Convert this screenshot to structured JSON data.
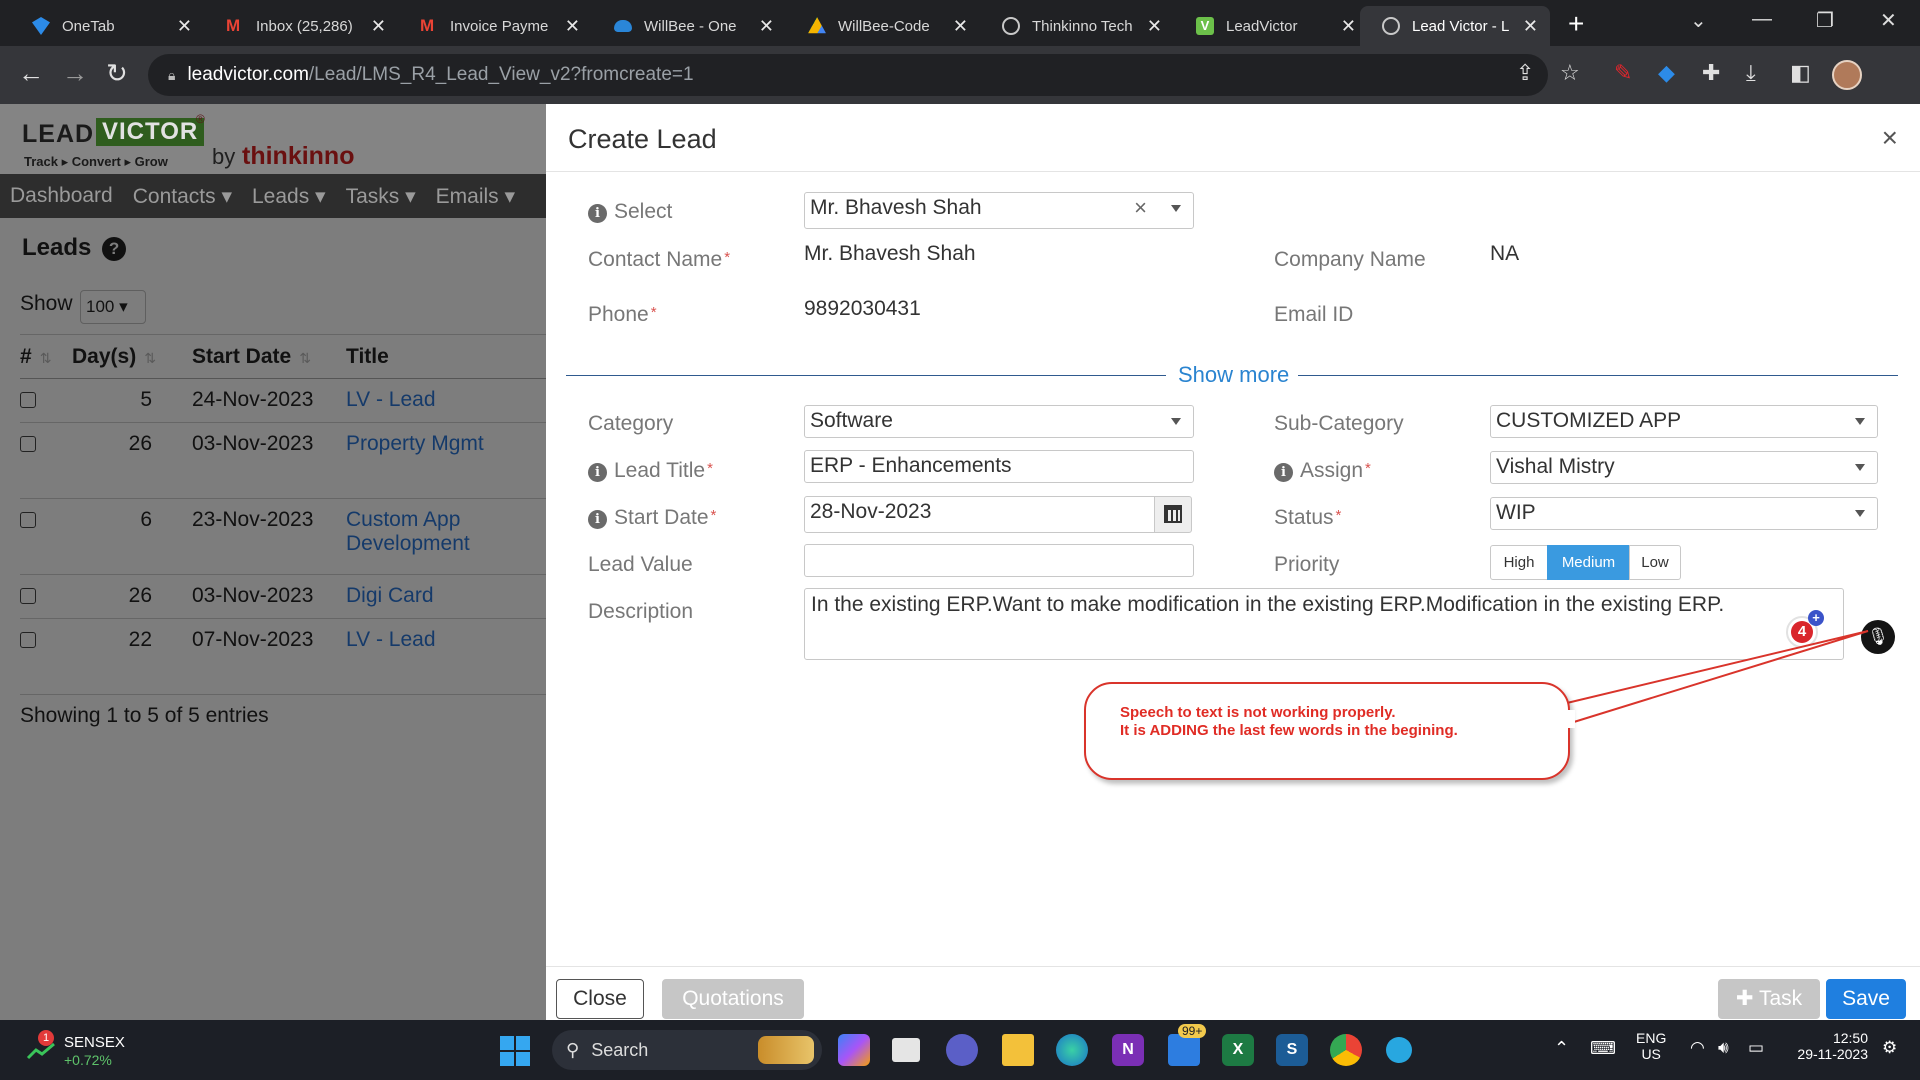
{
  "browser": {
    "tabs": [
      {
        "label": "OneTab",
        "icon": "onetab-icon",
        "color": "#2c8be8"
      },
      {
        "label": "Inbox (25,286)",
        "icon": "gmail-icon",
        "color": "#ea4335"
      },
      {
        "label": "Invoice Payme",
        "icon": "gmail-icon",
        "color": "#ea4335"
      },
      {
        "label": "WillBee - One",
        "icon": "onedrive-icon",
        "color": "#2a86d8"
      },
      {
        "label": "WillBee-Code",
        "icon": "google-drive-icon",
        "color": "#f4b400"
      },
      {
        "label": "Thinkinno Tech",
        "icon": "globe-icon",
        "color": "#c8c8c8"
      },
      {
        "label": "LeadVictor",
        "icon": "leadvictor-icon",
        "color": "#6cc04a"
      },
      {
        "label": "Lead Victor - L",
        "icon": "globe-icon",
        "color": "#c8c8c8"
      }
    ],
    "url_host": "leadvictor.com",
    "url_path": "/Lead/LMS_R4_Lead_View_v2?fromcreate=1"
  },
  "app": {
    "logo_lead": "LEAD",
    "logo_victor": "VICTOR",
    "logo_tagline": "Track ▸ Convert ▸ Grow",
    "logo_by": "by",
    "logo_company": "thinkinno",
    "nav": [
      "Dashboard",
      "Contacts ▾",
      "Leads ▾",
      "Tasks ▾",
      "Emails ▾"
    ],
    "page_title": "Leads",
    "show_label": "Show",
    "show_value": "100 ▾",
    "table_headers": [
      "#",
      "Day(s)",
      "Start Date",
      "Title"
    ],
    "rows": [
      {
        "days": "5",
        "start": "24-Nov-2023",
        "title": "LV - Lead",
        "title2": ""
      },
      {
        "days": "26",
        "start": "03-Nov-2023",
        "title": "Property Mgmt",
        "title2": ""
      },
      {
        "days": "6",
        "start": "23-Nov-2023",
        "title": "Custom App",
        "title2": "Development"
      },
      {
        "days": "26",
        "start": "03-Nov-2023",
        "title": "Digi Card",
        "title2": ""
      },
      {
        "days": "22",
        "start": "07-Nov-2023",
        "title": "LV - Lead",
        "title2": ""
      }
    ],
    "showing": "Showing 1 to 5 of 5 entries"
  },
  "modal": {
    "title": "Create Lead",
    "close_glyph": "×",
    "select_label": "Select",
    "select_value": "Mr. Bhavesh Shah",
    "contact_name_label": "Contact Name",
    "contact_name_value": "Mr. Bhavesh Shah",
    "company_name_label": "Company Name",
    "company_name_value": "NA",
    "phone_label": "Phone",
    "phone_value": "9892030431",
    "email_label": "Email ID",
    "email_value": "",
    "show_more": "Show more",
    "category_label": "Category",
    "category_value": "Software",
    "subcategory_label": "Sub-Category",
    "subcategory_value": "CUSTOMIZED APP",
    "lead_title_label": "Lead Title",
    "lead_title_value": "ERP - Enhancements",
    "assign_label": "Assign",
    "assign_value": "Vishal Mistry",
    "start_date_label": "Start Date",
    "start_date_value": "28-Nov-2023",
    "status_label": "Status",
    "status_value": "WIP",
    "lead_value_label": "Lead Value",
    "lead_value_value": "",
    "priority_label": "Priority",
    "priority_options": [
      "High",
      "Medium",
      "Low"
    ],
    "priority_selected": "Medium",
    "description_label": "Description",
    "description_value": "In the existing ERP.Want to make modification in the existing ERP.Modification in the existing ERP.",
    "badge_count": "4",
    "callout_line1": "Speech to text is not working properly.",
    "callout_line2": "It is ADDING the last few words in the begining.",
    "footer": {
      "close": "Close",
      "quotations": "Quotations",
      "task": "Task",
      "save": "Save"
    }
  },
  "taskbar": {
    "stock_name": "SENSEX",
    "stock_change": "+0.72%",
    "stock_badge": "1",
    "search_label": "Search",
    "notif_badge": "99+",
    "lang_top": "ENG",
    "lang_bottom": "US",
    "time": "12:50",
    "date": "29-11-2023"
  },
  "colors": {
    "accent_blue": "#1f7fe0",
    "priority_active": "#3a9ae0",
    "callout_red": "#e02c25"
  }
}
